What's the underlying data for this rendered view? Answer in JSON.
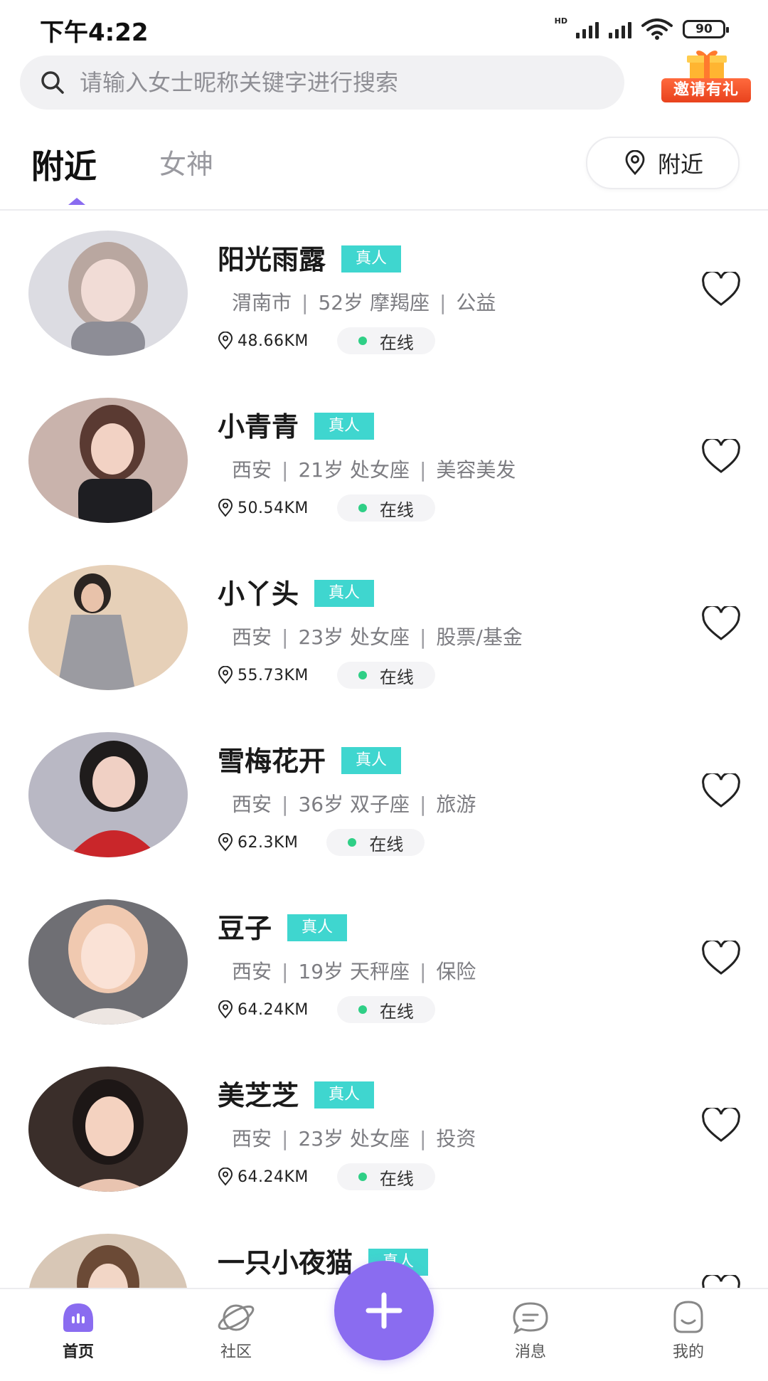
{
  "status_bar": {
    "time": "下午4:22",
    "network": "HD",
    "battery": "90"
  },
  "search": {
    "placeholder": "请输入女士昵称关键字进行搜索"
  },
  "invite": {
    "label": "邀请有礼"
  },
  "tabs": {
    "nearby": "附近",
    "goddess": "女神",
    "location_filter": "附近"
  },
  "users": [
    {
      "name": "阳光雨露",
      "badge": "真人",
      "city": "渭南市",
      "age_sign": "52岁 摩羯座",
      "occupation": "公益",
      "distance": "48.66KM",
      "status": "在线"
    },
    {
      "name": "小青青",
      "badge": "真人",
      "city": "西安",
      "age_sign": "21岁 处女座",
      "occupation": "美容美发",
      "distance": "50.54KM",
      "status": "在线"
    },
    {
      "name": "小丫头",
      "badge": "真人",
      "city": "西安",
      "age_sign": "23岁 处女座",
      "occupation": "股票/基金",
      "distance": "55.73KM",
      "status": "在线"
    },
    {
      "name": "雪梅花开",
      "badge": "真人",
      "city": "西安",
      "age_sign": "36岁 双子座",
      "occupation": "旅游",
      "distance": "62.3KM",
      "status": "在线"
    },
    {
      "name": "豆子",
      "badge": "真人",
      "city": "西安",
      "age_sign": "19岁 天秤座",
      "occupation": "保险",
      "distance": "64.24KM",
      "status": "在线"
    },
    {
      "name": "美芝芝",
      "badge": "真人",
      "city": "西安",
      "age_sign": "23岁 处女座",
      "occupation": "投资",
      "distance": "64.24KM",
      "status": "在线"
    },
    {
      "name": "一只小夜猫",
      "badge": "真人",
      "city": "",
      "age_sign": "",
      "occupation": "",
      "distance": "",
      "status": ""
    }
  ],
  "nav": {
    "home": "首页",
    "community": "社区",
    "messages": "消息",
    "mine": "我的"
  },
  "colors": {
    "accent": "#8a6cf0",
    "badge": "#3fd6cf",
    "online": "#2fcf86"
  }
}
